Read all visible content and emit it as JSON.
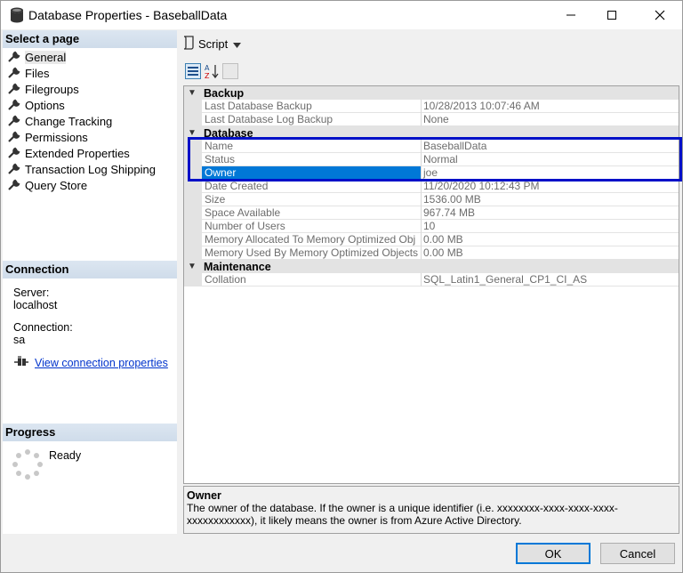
{
  "window": {
    "title": "Database Properties - BaseballData"
  },
  "left": {
    "select_page_header": "Select a page",
    "pages": [
      {
        "label": "General"
      },
      {
        "label": "Files"
      },
      {
        "label": "Filegroups"
      },
      {
        "label": "Options"
      },
      {
        "label": "Change Tracking"
      },
      {
        "label": "Permissions"
      },
      {
        "label": "Extended Properties"
      },
      {
        "label": "Transaction Log Shipping"
      },
      {
        "label": "Query Store"
      }
    ],
    "connection_header": "Connection",
    "server_label": "Server:",
    "server_value": "localhost",
    "connection_label": "Connection:",
    "connection_value": "sa",
    "view_connection_link": "View connection properties",
    "progress_header": "Progress",
    "progress_status": "Ready"
  },
  "toolbar": {
    "script_label": "Script"
  },
  "grid": {
    "categories": [
      {
        "name": "Backup",
        "rows": [
          {
            "name": "Last Database Backup",
            "value": "10/28/2013 10:07:46 AM"
          },
          {
            "name": "Last Database Log Backup",
            "value": "None"
          }
        ]
      },
      {
        "name": "Database",
        "rows": [
          {
            "name": "Name",
            "value": "BaseballData"
          },
          {
            "name": "Status",
            "value": "Normal"
          },
          {
            "name": "Owner",
            "value": "joe"
          },
          {
            "name": "Date Created",
            "value": "11/20/2020 10:12:43 PM"
          },
          {
            "name": "Size",
            "value": "1536.00 MB"
          },
          {
            "name": "Space Available",
            "value": "967.74 MB"
          },
          {
            "name": "Number of Users",
            "value": "10"
          },
          {
            "name": "Memory Allocated To Memory Optimized Obj",
            "value": "0.00 MB"
          },
          {
            "name": "Memory Used By Memory Optimized Objects",
            "value": "0.00 MB"
          }
        ]
      },
      {
        "name": "Maintenance",
        "rows": [
          {
            "name": "Collation",
            "value": "SQL_Latin1_General_CP1_CI_AS"
          }
        ]
      }
    ]
  },
  "description": {
    "title": "Owner",
    "text": "The owner of the database. If the owner is a unique identifier (i.e. xxxxxxxx-xxxx-xxxx-xxxx-xxxxxxxxxxxx), it likely means the owner is from Azure Active Directory."
  },
  "buttons": {
    "ok": "OK",
    "cancel": "Cancel"
  },
  "colors": {
    "selection": "#0078d7",
    "highlight_box": "#0010c8",
    "section_header": "#dce6f1",
    "link": "#0033cc"
  }
}
